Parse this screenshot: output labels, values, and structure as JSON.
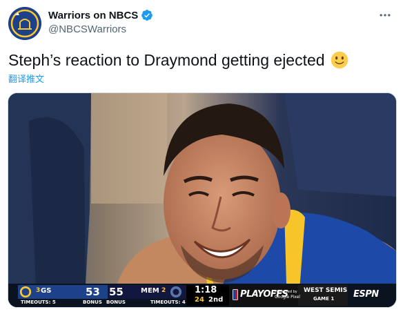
{
  "tweet": {
    "display_name": "Warriors on NBCS",
    "handle": "@NBCSWarriors",
    "text": "Steph’s reaction to Draymond getting ejected",
    "emoji": "slightly-smiling-face",
    "translate_label": "翻译推文",
    "more_icon": "more-horizontal-icon",
    "verified_icon": "verified-badge-icon"
  },
  "scorebug": {
    "home_abbr": "GS",
    "home_seed": "3",
    "home_score": "53",
    "home_timeouts": "TIMEOUTS: 5",
    "home_bonus": "BONUS",
    "away_score": "55",
    "away_bonus": "BONUS",
    "away_abbr": "MEM",
    "away_seed": "2",
    "away_timeouts": "TIMEOUTS: 4",
    "clock": "1:18",
    "shot_clock": "24",
    "period": "2nd",
    "event": "PLAYOFFS",
    "sponsor_line1": "Presented by",
    "sponsor_line2": "Google Pixel",
    "series": "WEST SEMIS",
    "game": "GAME 1",
    "network": "ESPN"
  },
  "colors": {
    "accent": "#1d9bf0",
    "warriors_blue": "#1d428a",
    "warriors_gold": "#ffc72c",
    "grizzlies_navy": "#12173f"
  }
}
